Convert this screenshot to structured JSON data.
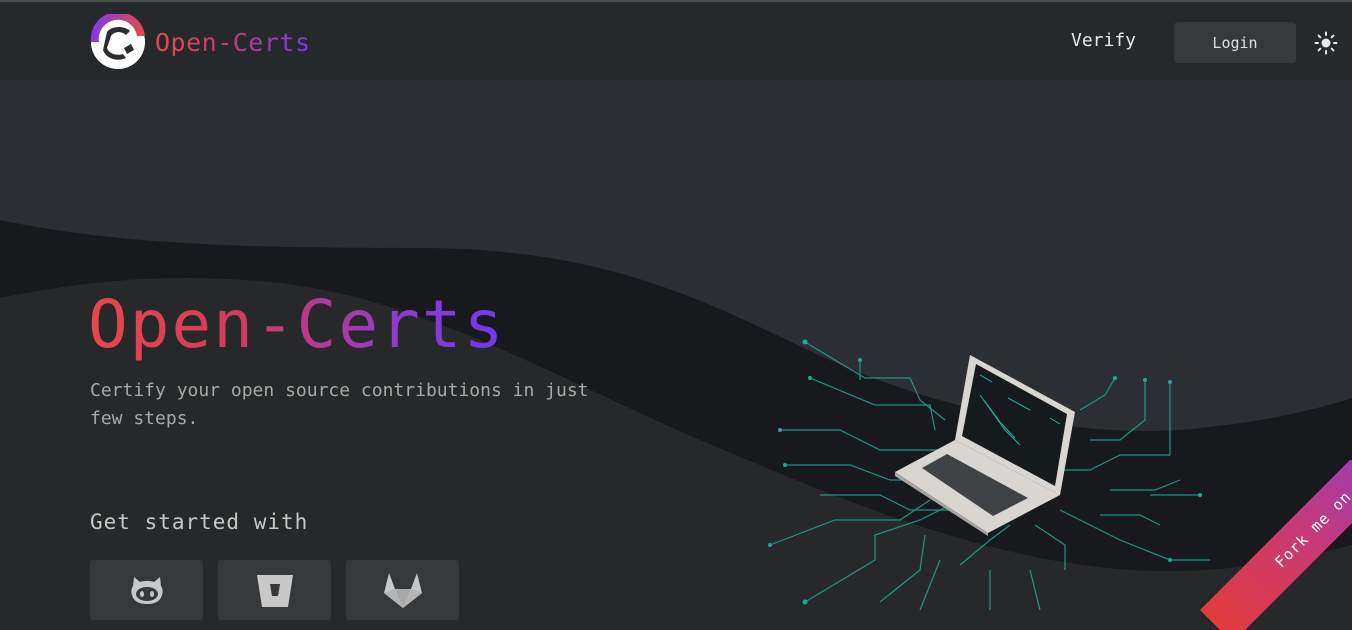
{
  "brand": {
    "name": "Open-Certs",
    "logo_icon": "open-certs-logo-icon"
  },
  "nav": {
    "verify_label": "Verify",
    "login_label": "Login",
    "theme_toggle_icon": "sun-icon"
  },
  "hero": {
    "title": "Open-Certs",
    "subtitle": "Certify your open source contributions in just few steps.",
    "get_started_label": "Get started with",
    "providers": [
      {
        "name": "GitHub",
        "icon": "github-icon"
      },
      {
        "name": "Bitbucket",
        "icon": "bitbucket-icon"
      },
      {
        "name": "GitLab",
        "icon": "gitlab-icon"
      }
    ],
    "illustration": "laptop-circuit-illustration"
  },
  "ribbon": {
    "label": "Fork me on",
    "icon": "github-icon"
  },
  "colors": {
    "background": "#26292b",
    "wave_dark": "#17191d",
    "accent_red": "#e44a4a",
    "accent_purple": "#7c3aed",
    "button_bg": "#35393c",
    "circuit": "#1fa89a"
  }
}
